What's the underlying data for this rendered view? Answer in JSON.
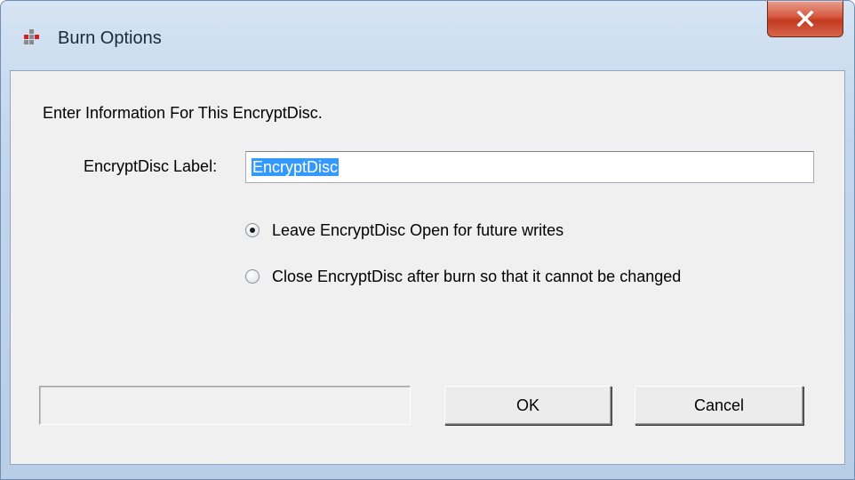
{
  "window": {
    "title": "Burn Options",
    "icon": "encryptdisc-app-icon"
  },
  "form": {
    "heading": "Enter Information For This EncryptDisc.",
    "label_text": "EncryptDisc Label:",
    "label_value": "EncryptDisc"
  },
  "options": [
    {
      "label": "Leave EncryptDisc Open for future writes",
      "checked": true
    },
    {
      "label": "Close EncryptDisc after burn so that it cannot be changed",
      "checked": false
    }
  ],
  "buttons": {
    "ok": "OK",
    "cancel": "Cancel"
  },
  "status": {
    "text": ""
  },
  "colors": {
    "selection": "#3399ff",
    "close_button": "#c9452b",
    "frame": "#c3d6ec"
  }
}
